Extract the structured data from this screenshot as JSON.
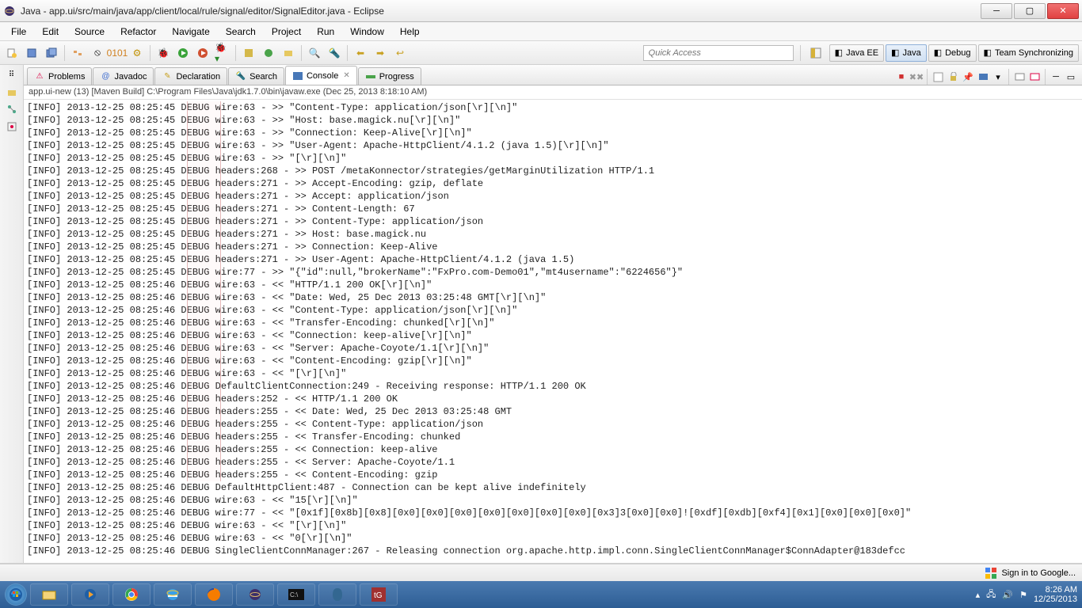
{
  "window": {
    "title": "Java - app.ui/src/main/java/app/client/local/rule/signal/editor/SignalEditor.java - Eclipse"
  },
  "menu": [
    "File",
    "Edit",
    "Source",
    "Refactor",
    "Navigate",
    "Search",
    "Project",
    "Run",
    "Window",
    "Help"
  ],
  "quick_access": {
    "placeholder": "Quick Access"
  },
  "perspectives": [
    {
      "label": "Java EE",
      "icon": "java-ee-icon"
    },
    {
      "label": "Java",
      "icon": "java-icon",
      "selected": true
    },
    {
      "label": "Debug",
      "icon": "debug-icon"
    },
    {
      "label": "Team Synchronizing",
      "icon": "team-sync-icon"
    }
  ],
  "tabs": [
    {
      "label": "Problems",
      "icon": "problems-icon"
    },
    {
      "label": "Javadoc",
      "icon": "javadoc-icon"
    },
    {
      "label": "Declaration",
      "icon": "declaration-icon"
    },
    {
      "label": "Search",
      "icon": "search-icon"
    },
    {
      "label": "Console",
      "icon": "console-icon",
      "active": true,
      "closable": true
    },
    {
      "label": "Progress",
      "icon": "progress-icon"
    }
  ],
  "launch_info": "app.ui-new (13) [Maven Build] C:\\Program Files\\Java\\jdk1.7.0\\bin\\javaw.exe (Dec 25, 2013 8:18:10 AM)",
  "highlight": {
    "left_ch": 28,
    "width_ch": 6
  },
  "console_lines": [
    "[INFO] 2013-12-25 08:25:45 DEBUG wire:63 - >> \"Content-Type: application/json[\\r][\\n]\"",
    "[INFO] 2013-12-25 08:25:45 DEBUG wire:63 - >> \"Host: base.magick.nu[\\r][\\n]\"",
    "[INFO] 2013-12-25 08:25:45 DEBUG wire:63 - >> \"Connection: Keep-Alive[\\r][\\n]\"",
    "[INFO] 2013-12-25 08:25:45 DEBUG wire:63 - >> \"User-Agent: Apache-HttpClient/4.1.2 (java 1.5)[\\r][\\n]\"",
    "[INFO] 2013-12-25 08:25:45 DEBUG wire:63 - >> \"[\\r][\\n]\"",
    "[INFO] 2013-12-25 08:25:45 DEBUG headers:268 - >> POST /metaKonnector/strategies/getMarginUtilization HTTP/1.1",
    "[INFO] 2013-12-25 08:25:45 DEBUG headers:271 - >> Accept-Encoding: gzip, deflate",
    "[INFO] 2013-12-25 08:25:45 DEBUG headers:271 - >> Accept: application/json",
    "[INFO] 2013-12-25 08:25:45 DEBUG headers:271 - >> Content-Length: 67",
    "[INFO] 2013-12-25 08:25:45 DEBUG headers:271 - >> Content-Type: application/json",
    "[INFO] 2013-12-25 08:25:45 DEBUG headers:271 - >> Host: base.magick.nu",
    "[INFO] 2013-12-25 08:25:45 DEBUG headers:271 - >> Connection: Keep-Alive",
    "[INFO] 2013-12-25 08:25:45 DEBUG headers:271 - >> User-Agent: Apache-HttpClient/4.1.2 (java 1.5)",
    "[INFO] 2013-12-25 08:25:45 DEBUG wire:77 - >> \"{\"id\":null,\"brokerName\":\"FxPro.com-Demo01\",\"mt4username\":\"6224656\"}\"",
    "[INFO] 2013-12-25 08:25:46 DEBUG wire:63 - << \"HTTP/1.1 200 OK[\\r][\\n]\"",
    "[INFO] 2013-12-25 08:25:46 DEBUG wire:63 - << \"Date: Wed, 25 Dec 2013 03:25:48 GMT[\\r][\\n]\"",
    "[INFO] 2013-12-25 08:25:46 DEBUG wire:63 - << \"Content-Type: application/json[\\r][\\n]\"",
    "[INFO] 2013-12-25 08:25:46 DEBUG wire:63 - << \"Transfer-Encoding: chunked[\\r][\\n]\"",
    "[INFO] 2013-12-25 08:25:46 DEBUG wire:63 - << \"Connection: keep-alive[\\r][\\n]\"",
    "[INFO] 2013-12-25 08:25:46 DEBUG wire:63 - << \"Server: Apache-Coyote/1.1[\\r][\\n]\"",
    "[INFO] 2013-12-25 08:25:46 DEBUG wire:63 - << \"Content-Encoding: gzip[\\r][\\n]\"",
    "[INFO] 2013-12-25 08:25:46 DEBUG wire:63 - << \"[\\r][\\n]\"",
    "[INFO] 2013-12-25 08:25:46 DEBUG DefaultClientConnection:249 - Receiving response: HTTP/1.1 200 OK",
    "[INFO] 2013-12-25 08:25:46 DEBUG headers:252 - << HTTP/1.1 200 OK",
    "[INFO] 2013-12-25 08:25:46 DEBUG headers:255 - << Date: Wed, 25 Dec 2013 03:25:48 GMT",
    "[INFO] 2013-12-25 08:25:46 DEBUG headers:255 - << Content-Type: application/json",
    "[INFO] 2013-12-25 08:25:46 DEBUG headers:255 - << Transfer-Encoding: chunked",
    "[INFO] 2013-12-25 08:25:46 DEBUG headers:255 - << Connection: keep-alive",
    "[INFO] 2013-12-25 08:25:46 DEBUG headers:255 - << Server: Apache-Coyote/1.1",
    "[INFO] 2013-12-25 08:25:46 DEBUG headers:255 - << Content-Encoding: gzip",
    "[INFO] 2013-12-25 08:25:46 DEBUG DefaultHttpClient:487 - Connection can be kept alive indefinitely",
    "[INFO] 2013-12-25 08:25:46 DEBUG wire:63 - << \"15[\\r][\\n]\"",
    "[INFO] 2013-12-25 08:25:46 DEBUG wire:77 - << \"[0x1f][0x8b][0x8][0x0][0x0][0x0][0x0][0x0][0x0][0x0][0x3]3[0x0][0x0]![0xdf][0xdb][0xf4][0x1][0x0][0x0][0x0]\"",
    "[INFO] 2013-12-25 08:25:46 DEBUG wire:63 - << \"[\\r][\\n]\"",
    "[INFO] 2013-12-25 08:25:46 DEBUG wire:63 - << \"0[\\r][\\n]\"",
    "[INFO] 2013-12-25 08:25:46 DEBUG SingleClientConnManager:267 - Releasing connection org.apache.http.impl.conn.SingleClientConnManager$ConnAdapter@183defcc"
  ],
  "status": {
    "signin": "Sign in to Google..."
  },
  "tray": {
    "time": "8:26 AM",
    "date": "12/25/2013"
  }
}
